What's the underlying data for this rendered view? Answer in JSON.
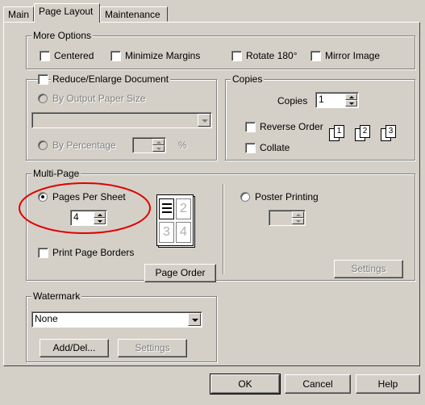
{
  "tabs": [
    "Main",
    "Page Layout",
    "Maintenance"
  ],
  "more_options": {
    "title": "More Options",
    "centered": "Centered",
    "minimize_margins": "Minimize Margins",
    "rotate": "Rotate 180°",
    "mirror": "Mirror Image"
  },
  "reduce": {
    "title": "Reduce/Enlarge Document",
    "by_output": "By Output Paper Size",
    "by_percentage": "By Percentage",
    "percent_sign": "%"
  },
  "copies": {
    "title": "Copies",
    "label": "Copies",
    "value": "1",
    "reverse_order": "Reverse Order",
    "collate": "Collate",
    "icon_pages": [
      "1",
      "2",
      "3"
    ]
  },
  "multipage": {
    "title": "Multi-Page",
    "pages_per_sheet": "Pages Per Sheet",
    "pages_value": "4",
    "print_borders": "Print Page Borders",
    "page_order": "Page Order",
    "poster": "Poster Printing",
    "settings": "Settings",
    "preview_numbers": [
      "2",
      "3",
      "4"
    ]
  },
  "watermark": {
    "title": "Watermark",
    "selected": "None",
    "add_del": "Add/Del...",
    "settings": "Settings"
  },
  "footer": {
    "ok": "OK",
    "cancel": "Cancel",
    "help": "Help"
  },
  "highlight_color": "#e00000"
}
